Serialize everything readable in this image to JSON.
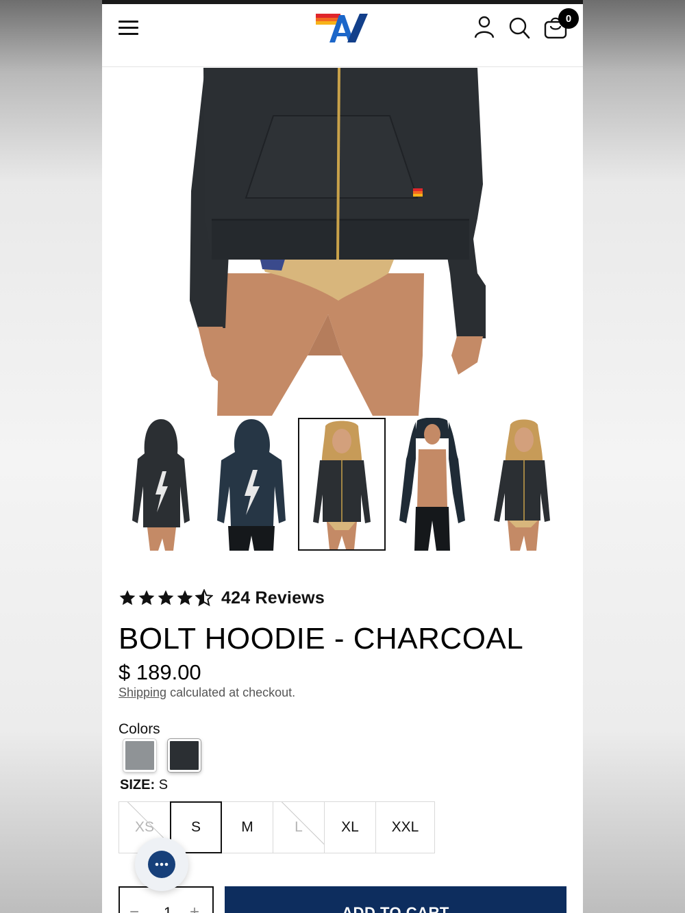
{
  "header": {
    "menu_icon": "hamburger-menu-icon",
    "logo_icon": "av-brand-logo",
    "account_icon": "user-account-icon",
    "search_icon": "search-icon",
    "cart_icon": "shopping-bag-icon",
    "cart_count": "0"
  },
  "gallery": {
    "selected_index": 2,
    "thumbnails": [
      {
        "name": "back-view-woman"
      },
      {
        "name": "back-view-man"
      },
      {
        "name": "front-view-woman"
      },
      {
        "name": "front-view-man"
      },
      {
        "name": "side-view-woman"
      }
    ]
  },
  "product": {
    "rating": 4.5,
    "reviews_label": "424 Reviews",
    "title": "BOLT HOODIE - CHARCOAL",
    "price": "$ 189.00",
    "shipping_link": "Shipping",
    "shipping_text": " calculated at checkout.",
    "colors_label": "Colors",
    "colors": [
      {
        "name": "grey",
        "hex": "#8f9396"
      },
      {
        "name": "charcoal",
        "hex": "#2b2f33",
        "selected": true
      }
    ],
    "size_label": "SIZE:",
    "size_value": "S",
    "sizes": [
      {
        "label": "XS",
        "available": false
      },
      {
        "label": "S",
        "available": true,
        "selected": true
      },
      {
        "label": "M",
        "available": true
      },
      {
        "label": "L",
        "available": false
      },
      {
        "label": "XL",
        "available": true
      },
      {
        "label": "XXL",
        "available": true
      }
    ]
  },
  "purchase": {
    "quantity": "1",
    "minus": "−",
    "plus": "+",
    "add_to_cart": "ADD TO CART"
  },
  "chat": {
    "icon": "chat-bubble-icon"
  },
  "colors": {
    "brand_navy": "#0d2d5e",
    "chat_blue": "#17407a"
  }
}
